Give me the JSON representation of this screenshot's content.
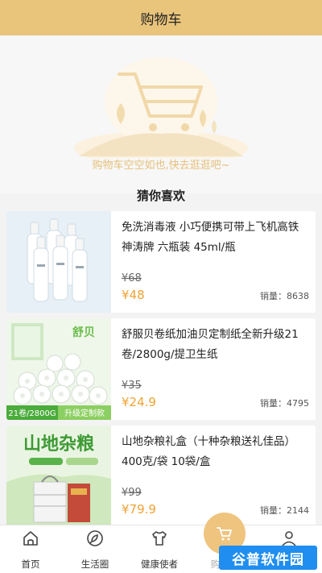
{
  "header": {
    "title": "购物车"
  },
  "empty_cart": {
    "message": "购物车空空如也,快去逛逛吧~"
  },
  "recommend": {
    "title": "猜你喜欢",
    "products": [
      {
        "name": "免洗消毒液 小巧便携可带上飞机高铁神涛牌 六瓶装 45ml/瓶",
        "orig_price": "¥68",
        "price": "¥48",
        "sales": "销量：8638",
        "image_icon": "hand-sanitizer-bottles"
      },
      {
        "name": "舒服贝卷纸加油贝定制纸全新升级21卷/2800g/提卫生纸",
        "orig_price": "¥35",
        "price": "¥24.9",
        "sales": "销量：4795",
        "image_icon": "toilet-paper-rolls",
        "image_texts": {
          "brand": "舒贝",
          "spec": "21卷/2800G",
          "tag": "升级定制款"
        }
      },
      {
        "name": "山地杂粮礼盒（十种杂粮送礼佳品）400克/袋 10袋/盒",
        "orig_price": "¥99",
        "price": "¥79.9",
        "sales": "销量：2144",
        "image_icon": "grain-gift-box",
        "image_texts": {
          "headline": "山地杂粮"
        }
      }
    ]
  },
  "tabbar": {
    "items": [
      {
        "label": "首页",
        "icon": "home-icon"
      },
      {
        "label": "生活圈",
        "icon": "life-circle-icon"
      },
      {
        "label": "健康使者",
        "icon": "shirt-icon"
      },
      {
        "label": "购物车",
        "icon": "cart-icon"
      },
      {
        "label": "我的",
        "icon": "person-icon"
      }
    ]
  },
  "watermark": {
    "text": "谷普软件园"
  },
  "colors": {
    "header": "#e9c47b",
    "accent": "#f0a234",
    "empty_text": "#e6c07a"
  }
}
